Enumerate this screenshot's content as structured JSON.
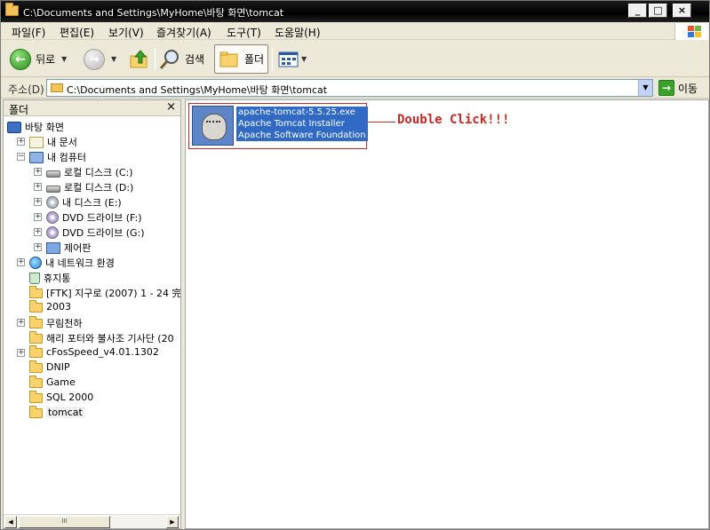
{
  "window": {
    "title": "C:\\Documents and Settings\\MyHome\\바탕 화면\\tomcat",
    "min_glyph": "_",
    "max_glyph": "□",
    "close_glyph": "×"
  },
  "menu": [
    "파일(F)",
    "편집(E)",
    "보기(V)",
    "즐겨찾기(A)",
    "도구(T)",
    "도움말(H)"
  ],
  "toolbar": {
    "back_label": "뒤로",
    "search_label": "검색",
    "folders_label": "폴더",
    "dropdown_glyph": "▼"
  },
  "address": {
    "label": "주소(D)",
    "value": "C:\\Documents and Settings\\MyHome\\바탕 화면\\tomcat",
    "go_label": "이동"
  },
  "folder_pane": {
    "title": "폴더",
    "close_glyph": "×",
    "scroll_thumb_grip": "III",
    "items": [
      {
        "label": "바탕 화면",
        "icon": "desktop-icon",
        "expander": ""
      },
      {
        "label": "내 문서",
        "icon": "my-documents-icon",
        "expander": "+"
      },
      {
        "label": "내 컴퓨터",
        "icon": "my-computer-icon",
        "expander": "−"
      },
      {
        "label": "로컬 디스크 (C:)",
        "icon": "hard-disk-icon",
        "expander": "+"
      },
      {
        "label": "로컬 디스크 (D:)",
        "icon": "hard-disk-icon",
        "expander": "+"
      },
      {
        "label": "내 디스크 (E:)",
        "icon": "cd-drive-icon",
        "expander": "+"
      },
      {
        "label": "DVD 드라이브 (F:)",
        "icon": "dvd-drive-icon",
        "expander": "+"
      },
      {
        "label": "DVD 드라이브 (G:)",
        "icon": "dvd-drive-icon",
        "expander": "+"
      },
      {
        "label": "제어판",
        "icon": "control-panel-icon",
        "expander": "+"
      },
      {
        "label": "내 네트워크 환경",
        "icon": "network-icon",
        "expander": "+"
      },
      {
        "label": "휴지통",
        "icon": "recycle-bin-icon",
        "expander": ""
      },
      {
        "label": "[FTK] 지구로 (2007) 1 - 24 完",
        "icon": "folder-icon",
        "expander": ""
      },
      {
        "label": "2003",
        "icon": "folder-icon",
        "expander": ""
      },
      {
        "label": "무림천하",
        "icon": "folder-icon",
        "expander": "+"
      },
      {
        "label": "해리 포터와 불사조 기사단 (20",
        "icon": "folder-icon",
        "expander": ""
      },
      {
        "label": "cFosSpeed_v4.01.1302",
        "icon": "folder-icon",
        "expander": "+"
      },
      {
        "label": "DNIP",
        "icon": "folder-icon",
        "expander": ""
      },
      {
        "label": "Game",
        "icon": "folder-icon",
        "expander": ""
      },
      {
        "label": "SQL 2000",
        "icon": "folder-icon",
        "expander": ""
      },
      {
        "label": "tomcat",
        "icon": "folder-icon",
        "expander": ""
      }
    ]
  },
  "content": {
    "file": {
      "name": "apache-tomcat-5.5.25.exe",
      "description": "Apache Tomcat Installer",
      "company": "Apache Software Foundation",
      "icon": "tomcat-installer-icon"
    },
    "annotation": "Double Click!!!"
  },
  "colors": {
    "selection": "#316ac5",
    "annotation": "#d0261f"
  }
}
